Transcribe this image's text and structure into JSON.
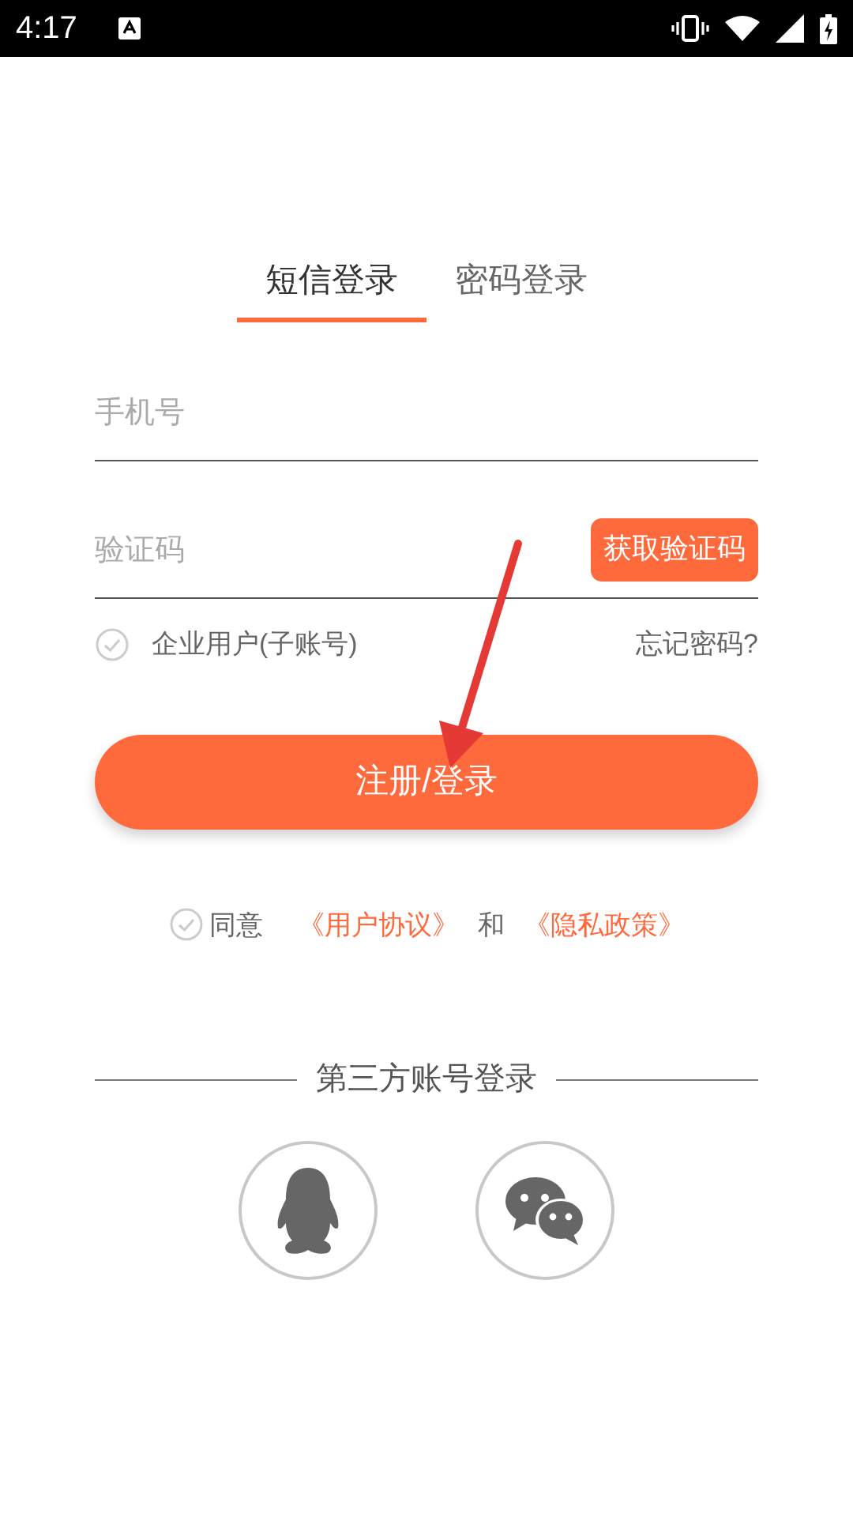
{
  "status_bar": {
    "time": "4:17"
  },
  "tabs": [
    {
      "label": "短信登录",
      "selected": true
    },
    {
      "label": "密码登录",
      "selected": false
    }
  ],
  "phone_field": {
    "placeholder": "手机号"
  },
  "code_field": {
    "placeholder": "验证码",
    "send_code_button": "获取验证码"
  },
  "enterprise_option": {
    "label": "企业用户(子账号)",
    "checked": false
  },
  "forgot_password": "忘记密码?",
  "login_button": "注册/登录",
  "agreement": {
    "checked": false,
    "prefix": "同意",
    "links": [
      "《用户协议》",
      "《隐私政策》"
    ],
    "conjunction": "和"
  },
  "third_party": {
    "title": "第三方账号登录",
    "providers": [
      {
        "kind": "qq"
      },
      {
        "kind": "wechat"
      }
    ]
  }
}
